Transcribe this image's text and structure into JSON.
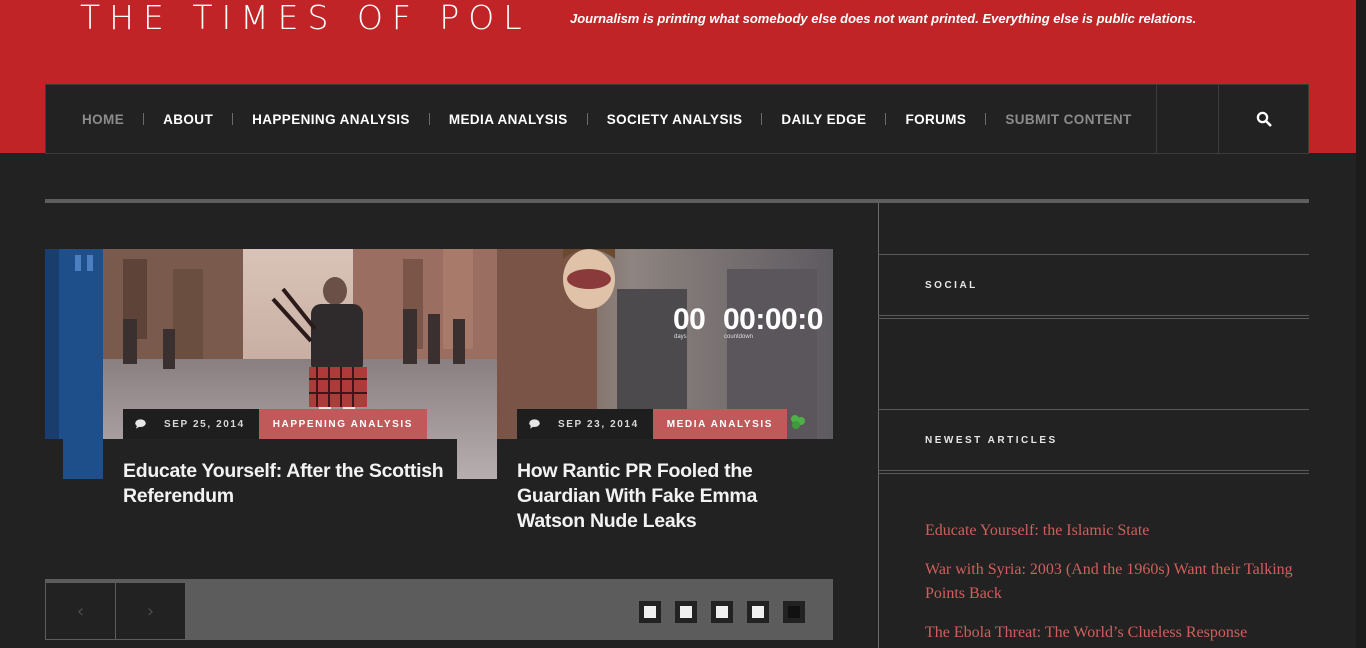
{
  "header": {
    "site_title": "THE TIMES OF POL",
    "tagline": "Journalism is printing what somebody else does not want printed. Everything else is public relations."
  },
  "nav": {
    "items": [
      {
        "label": "HOME"
      },
      {
        "label": "ABOUT"
      },
      {
        "label": "HAPPENING ANALYSIS"
      },
      {
        "label": "MEDIA ANALYSIS"
      },
      {
        "label": "SOCIETY ANALYSIS"
      },
      {
        "label": "DAILY EDGE"
      },
      {
        "label": "FORUMS"
      },
      {
        "label": "SUBMIT CONTENT"
      }
    ],
    "search_icon": "search-icon"
  },
  "slider": {
    "slides": [
      {
        "date": "SEP 25, 2014",
        "category": "HAPPENING ANALYSIS",
        "title": "Educate Yourself: After the Scottish Referendum",
        "comment_icon": "comment-icon"
      },
      {
        "date": "SEP 23, 2014",
        "category": "MEDIA ANALYSIS",
        "title": "How Rantic PR Fooled the Guardian With Fake Emma Watson Nude Leaks",
        "comment_icon": "comment-icon",
        "countdown": {
          "days": "00",
          "time": "00:00:0",
          "days_label": "days",
          "countdown_label": "countdown"
        }
      }
    ],
    "prev_label": "‹",
    "next_label": "›",
    "dot_count": 5,
    "active_dot": 5
  },
  "sidebar": {
    "social_heading": "SOCIAL",
    "newest_heading": "NEWEST ARTICLES",
    "articles": [
      {
        "title": "Educate Yourself: the Islamic State"
      },
      {
        "title": "War with Syria: 2003 (And the 1960s) Want their Talking Points Back"
      },
      {
        "title": "The Ebola Threat: The World’s Clueless Response"
      }
    ]
  },
  "colors": {
    "brand_red": "#c12426",
    "accent_link": "#cf5f5d",
    "category_badge": "#c0595a",
    "background": "#222222"
  }
}
